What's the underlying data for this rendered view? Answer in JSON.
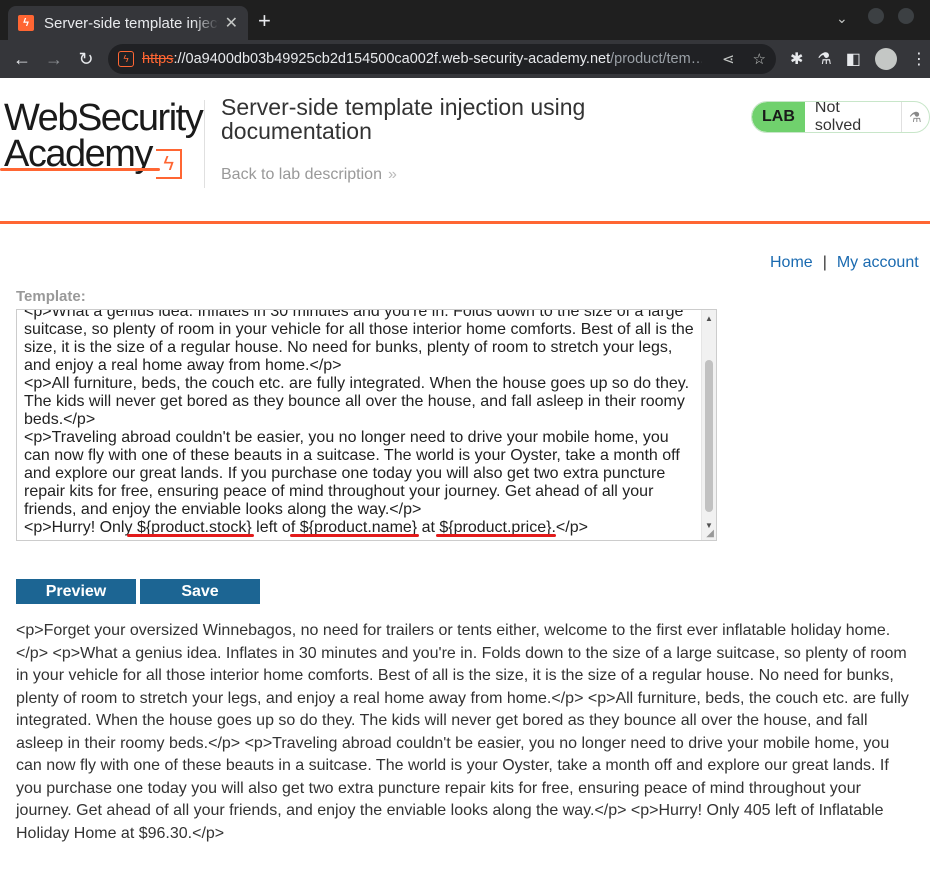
{
  "browser": {
    "tab_title": "Server-side template injection using documentation",
    "tab_close": "✕",
    "new_tab": "+",
    "url_protocol": "https",
    "url_host": "://0a9400db03b49925cb2d154500ca002f.web-security-academy.net",
    "url_path": "/product/tem…"
  },
  "header": {
    "logo_line1": "WebSecurity",
    "logo_line2": "Academy",
    "lab_title": "Server-side template injection using documentation",
    "back_link": "Back to lab description",
    "status_badge": "LAB",
    "status_text": "Not solved"
  },
  "nav": {
    "home": "Home",
    "separator": "|",
    "my_account": "My account"
  },
  "editor": {
    "label": "Template:",
    "line_partial": "<p>What a genius idea. Inflates in 30 minutes and you're in. Folds down to the size of a large",
    "para1_rest": "suitcase, so plenty of room in your vehicle for all those interior home comforts. Best of all is the size, it is the size of a regular house. No need for bunks, plenty of room to stretch your legs, and enjoy a real home away from home.</p>",
    "para2": "<p>All furniture, beds, the couch etc. are fully integrated. When the house goes up so do they. The kids will never get bored as they bounce all over the house, and fall asleep in their roomy beds.</p>",
    "para3": "<p>Traveling abroad couldn't be easier, you no longer need to drive your mobile home, you can now fly with one of these beauts in a suitcase. The world is your Oyster, take a month off and explore our great lands. If you purchase one today you will also get two extra puncture repair kits for free, ensuring peace of mind throughout your journey. Get ahead of all your friends, and enjoy the enviable looks along the way.</p>",
    "last_prefix": "<p>Hurry! Only ",
    "var_stock": "${product.stock}",
    "last_mid1": " left of ",
    "var_name": "${product.name}",
    "last_mid2": " at ",
    "var_price": "${product.price}",
    "last_suffix": ".</p>"
  },
  "buttons": {
    "preview": "Preview",
    "save": "Save"
  },
  "preview_output": "<p>Forget your oversized Winnebagos, no need for trailers or tents either, welcome to the first ever inflatable holiday home.</p> <p>What a genius idea. Inflates in 30 minutes and you're in. Folds down to the size of a large suitcase, so plenty of room in your vehicle for all those interior home comforts. Best of all is the size, it is the size of a regular house. No need for bunks, plenty of room to stretch your legs, and enjoy a real home away from home.</p> <p>All furniture, beds, the couch etc. are fully integrated. When the house goes up so do they. The kids will never get bored as they bounce all over the house, and fall asleep in their roomy beds.</p> <p>Traveling abroad couldn't be easier, you no longer need to drive your mobile home, you can now fly with one of these beauts in a suitcase. The world is your Oyster, take a month off and explore our great lands. If you purchase one today you will also get two extra puncture repair kits for free, ensuring peace of mind throughout your journey. Get ahead of all your friends, and enjoy the enviable looks along the way.</p> <p>Hurry! Only 405 left of Inflatable Holiday Home at $96.30.</p>",
  "colors": {
    "accent": "#ff6633",
    "button": "#1c6593",
    "link": "#1a6ab0",
    "lab_badge": "#70d16d",
    "annotation_underline": "#e31b1b"
  }
}
